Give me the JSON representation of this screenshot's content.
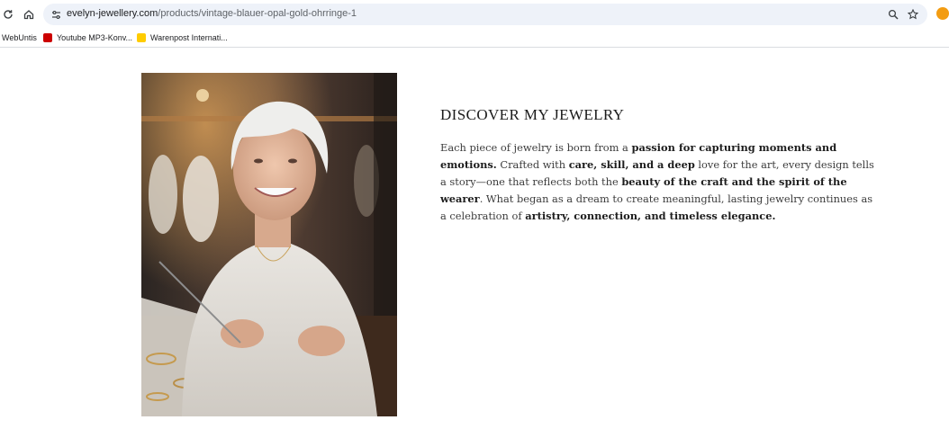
{
  "browser": {
    "url_host": "evelyn-jewellery.com",
    "url_path": "/products/vintage-blauer-opal-gold-ohrringe-1",
    "bookmarks": [
      {
        "label": "WebUntis",
        "icon": "webuntis-icon"
      },
      {
        "label": "Youtube MP3-Konv...",
        "icon": "youtube-icon"
      },
      {
        "label": "Warenpost Internati...",
        "icon": "post-icon"
      }
    ]
  },
  "section": {
    "heading": "DISCOVER MY JEWELRY",
    "paragraph": [
      {
        "text": "Each piece of jewelry is born from a ",
        "bold": false
      },
      {
        "text": "passion for capturing moments and emotions.",
        "bold": true
      },
      {
        "text": " Crafted with ",
        "bold": false
      },
      {
        "text": "care, skill, and a deep",
        "bold": true
      },
      {
        "text": " love for the art, every design tells a story—one that reflects both the ",
        "bold": false
      },
      {
        "text": "beauty of the craft and the spirit of the wearer",
        "bold": true
      },
      {
        "text": ". What began as a dream to create meaningful, lasting jewelry continues as a celebration of ",
        "bold": false
      },
      {
        "text": "artistry, connection, and timeless elegance.",
        "bold": true
      }
    ]
  },
  "colors": {
    "omnibox_bg": "#eef2f9",
    "profile": "#f39c12",
    "youtube": "#cc0000",
    "post": "#ffcc00"
  }
}
